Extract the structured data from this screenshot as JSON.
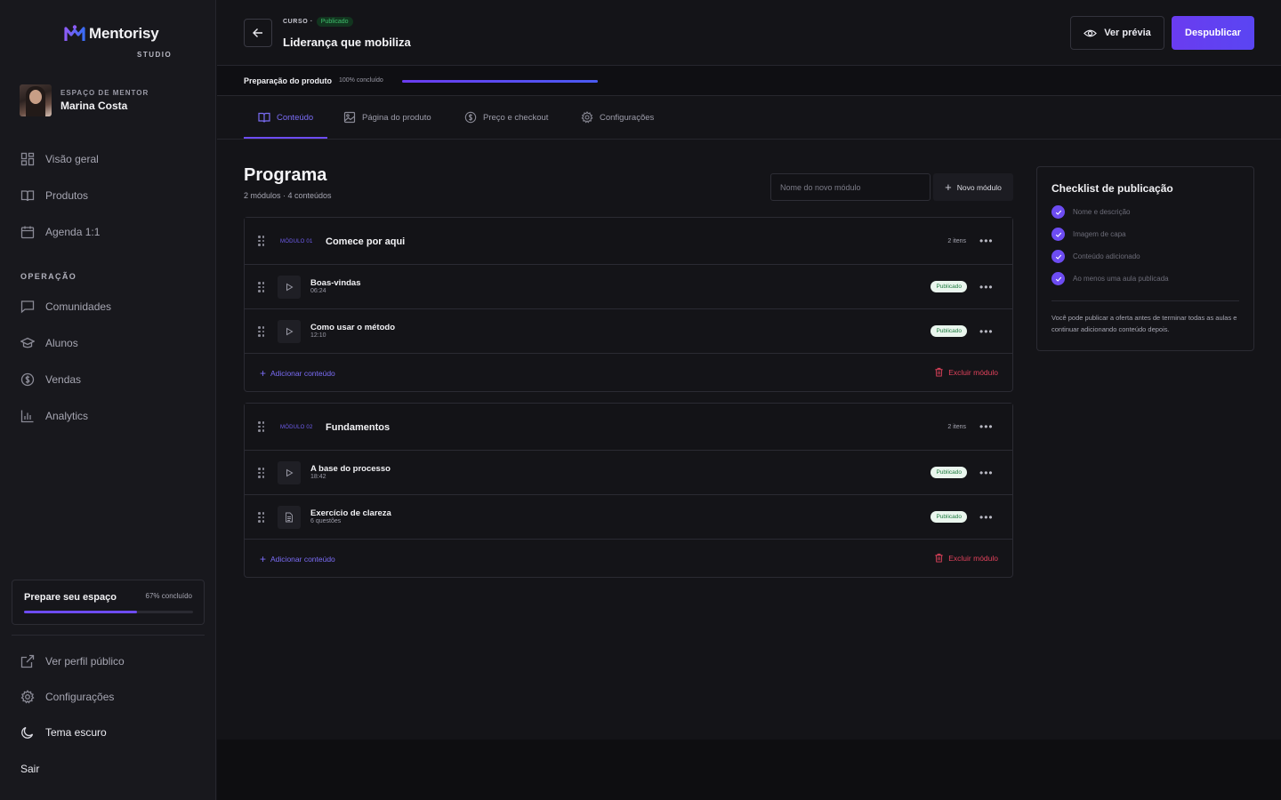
{
  "brand": {
    "name": "Mentorisy",
    "sub": "STUDIO"
  },
  "mentor": {
    "label": "ESPAÇO DE MENTOR",
    "name": "Marina Costa"
  },
  "nav": {
    "main": [
      {
        "label": "Visão geral",
        "icon": "grid-icon"
      },
      {
        "label": "Produtos",
        "icon": "book-icon"
      },
      {
        "label": "Agenda 1:1",
        "icon": "calendar-icon"
      }
    ],
    "section": "OPERAÇÃO",
    "operation": [
      {
        "label": "Comunidades",
        "icon": "chat-icon"
      },
      {
        "label": "Alunos",
        "icon": "graduation-cap-icon"
      },
      {
        "label": "Vendas",
        "icon": "dollar-circle-icon"
      },
      {
        "label": "Analytics",
        "icon": "bar-chart-icon"
      }
    ],
    "bottom": [
      {
        "label": "Ver perfil público",
        "icon": "external-link-icon"
      },
      {
        "label": "Configurações",
        "icon": "gear-icon"
      },
      {
        "label": "Tema escuro",
        "icon": "moon-icon"
      }
    ],
    "logout": "Sair"
  },
  "prep_card": {
    "title": "Prepare seu espaço",
    "pct_label": "67% concluído",
    "progress": 0.67
  },
  "header": {
    "crumb": "CURSO ·",
    "status": "Publicado",
    "title": "Liderança que mobiliza",
    "preview": "Ver prévia",
    "unpublish": "Despublicar"
  },
  "product_prep": {
    "label": "Preparação do produto",
    "pct_label": "100% concluído",
    "progress": 1.0
  },
  "tabs": [
    {
      "label": "Conteúdo",
      "icon": "book-open-icon",
      "active": true
    },
    {
      "label": "Página do produto",
      "icon": "image-icon",
      "active": false
    },
    {
      "label": "Preço e checkout",
      "icon": "dollar-circle-icon",
      "active": false
    },
    {
      "label": "Configurações",
      "icon": "gear-icon",
      "active": false
    }
  ],
  "program": {
    "title": "Programa",
    "subtitle": "2 módulos · 4 conteúdos",
    "new_placeholder": "Nome do novo módulo",
    "new_button": "Novo módulo"
  },
  "modules": [
    {
      "tag": "MÓDULO 01",
      "name": "Comece por aqui",
      "count": "2 itens",
      "items": [
        {
          "title": "Boas-vindas",
          "sub": "06:24",
          "status": "Publicado",
          "kind": "video"
        },
        {
          "title": "Como usar o método",
          "sub": "12:10",
          "status": "Publicado",
          "kind": "video"
        }
      ],
      "add": "Adicionar conteúdo",
      "delete": "Excluir módulo"
    },
    {
      "tag": "MÓDULO 02",
      "name": "Fundamentos",
      "count": "2 itens",
      "items": [
        {
          "title": "A base do processo",
          "sub": "18:42",
          "status": "Publicado",
          "kind": "video"
        },
        {
          "title": "Exercício de clareza",
          "sub": "6 questões",
          "status": "Publicado",
          "kind": "document"
        }
      ],
      "add": "Adicionar conteúdo",
      "delete": "Excluir módulo"
    }
  ],
  "checklist": {
    "title": "Checklist de publicação",
    "items": [
      "Nome e descrição",
      "Imagem de capa",
      "Conteúdo adicionado",
      "Ao menos uma aula publicada"
    ],
    "note": "Você pode publicar a oferta antes de terminar todas as aulas e continuar adicionando conteúdo depois."
  },
  "colors": {
    "accent": "#6d4cf2",
    "danger": "#e0425b",
    "success": "#3fbf6d"
  }
}
